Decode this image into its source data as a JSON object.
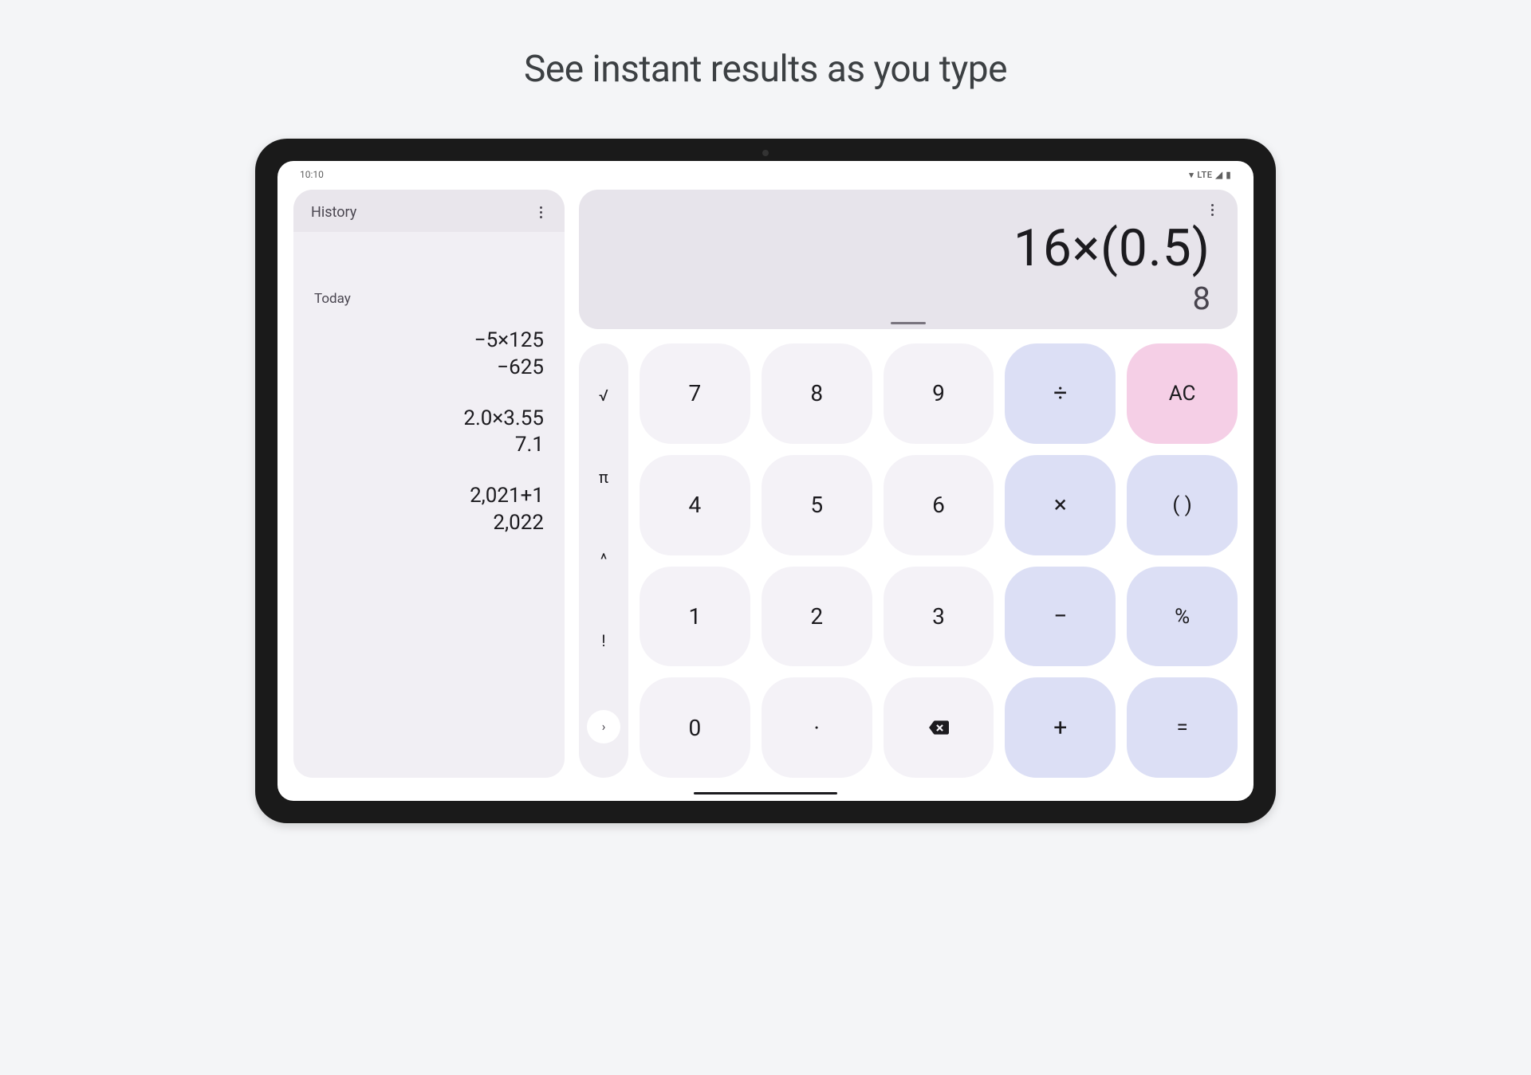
{
  "headline": "See instant results as you type",
  "statusbar": {
    "time": "10:10",
    "network": "LTE"
  },
  "history": {
    "title": "History",
    "group": "Today",
    "items": [
      {
        "expr": "−5×125",
        "result": "−625"
      },
      {
        "expr": "2.0×3.55",
        "result": "7.1"
      },
      {
        "expr": "2,021+1",
        "result": "2,022"
      }
    ]
  },
  "display": {
    "expression": "16×(0.5)",
    "result": "8"
  },
  "sci_keys": [
    "√",
    "π",
    "^",
    "!"
  ],
  "sci_expand": "›",
  "keypad": {
    "r0": {
      "n0": "7",
      "n1": "8",
      "n2": "9",
      "op": "÷",
      "fn": "AC"
    },
    "r1": {
      "n0": "4",
      "n1": "5",
      "n2": "6",
      "op": "×",
      "fn": "( )"
    },
    "r2": {
      "n0": "1",
      "n1": "2",
      "n2": "3",
      "op": "−",
      "fn": "%"
    },
    "r3": {
      "n0": "0",
      "n1": "·",
      "n2_is_backspace": true,
      "op": "+",
      "fn": "="
    }
  }
}
